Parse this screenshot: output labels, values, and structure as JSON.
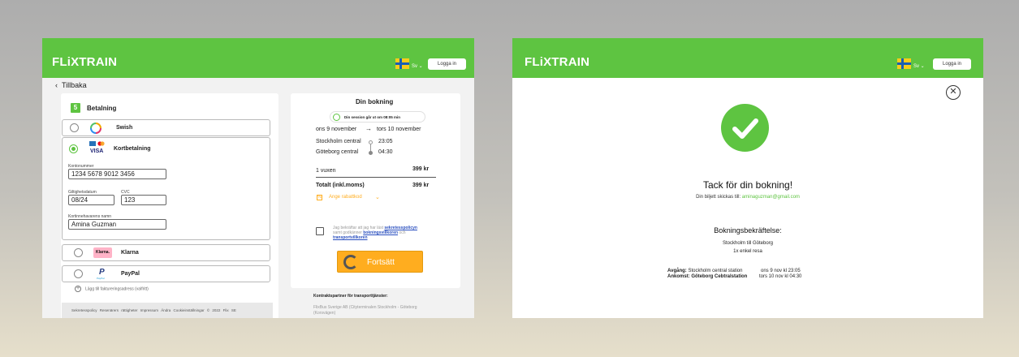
{
  "brand": {
    "logo": "FLiXTRAIN",
    "green": "#5ec441",
    "orange": "#ffad1f"
  },
  "header": {
    "lang": "Sv",
    "login_label": "Logga in",
    "login_label_2": "Logga in"
  },
  "payment": {
    "back_label": "Tillbaka",
    "step_number": "5",
    "step_title": "Betalning",
    "options": {
      "swish": "Swish",
      "card": "Kortbetalning",
      "klarna": "Klarna",
      "klarna_logo": "Klarna.",
      "paypal": "PayPal",
      "paypal_logo": "PayPal"
    },
    "card_form": {
      "account_label": "Kontonummer",
      "account_value": "1234 5678 9012 3456",
      "expiry_label": "Giltighetsdatum",
      "expiry_value": "08/24",
      "cvc_label": "CVC",
      "cvc_value": "123",
      "holder_label": "Kortinnehavarens namn",
      "holder_value": "Amina Guzman"
    },
    "add_billing": "Lägg till faktureringsadress (valfritt)",
    "footer": "Sekretesspolicy   Resenärers rättigheter   Impressum   Ändra Cookieinställningar     © 2022 Flix SE"
  },
  "summary": {
    "title": "Din bokning",
    "session": "Din session går ut om 08:05 min",
    "date_from": "ons 9 november",
    "date_to": "tors 10 november",
    "from_station": "Stockholm central",
    "from_time": "23:05",
    "to_station": "Göteborg central",
    "to_time": "04:30",
    "passenger_label": "1 vuxen",
    "passenger_price": "399 kr",
    "total_label": "Totalt (inkl.moms)",
    "total_price": "399 kr",
    "discount": "Ange rabattkod",
    "consent_1": "Jag bekräftar att jag har läst ",
    "consent_link1": "sekretesspolicyn",
    "consent_2": "samt godkänner ",
    "consent_link2": "bokningsvillkoren",
    "consent_3": " och",
    "consent_link3": "transportvillkoren",
    "continue_label": "Fortsätt",
    "partner_title": "Kontraktspartner för transporttjänster:",
    "partner_1": "FlixBus Sverige AB (Cityterminalen Stockholm - Göteborg",
    "partner_2": "(Korsvägen)"
  },
  "confirmation": {
    "thanks": "Tack för din bokning!",
    "email_prefix": "Din biljett skickas till: ",
    "email": "aminaguzman@gmail.com",
    "heading": "Bokningsbekräftelse:",
    "route": "Stockholm till Göteborg",
    "ticket": "1x enkel resa",
    "dep_label": "Avgång:",
    "dep_station": "Stockholm central station",
    "dep_time": "ons 9 nov kl 23:05",
    "arr_label": "Ankomst:",
    "arr_station": "Göteborg Cebtralstation",
    "arr_time": "tors  10 nov kl 04:30"
  }
}
